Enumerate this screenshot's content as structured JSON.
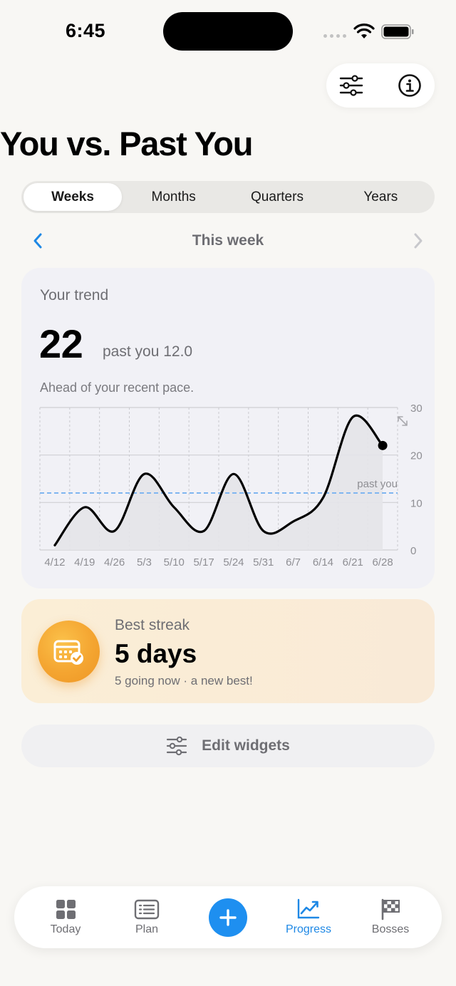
{
  "status_bar": {
    "time": "6:45"
  },
  "header": {
    "title": "You vs. Past You",
    "filters_icon": "sliders-icon",
    "info_icon": "info-circle-icon"
  },
  "segments": [
    {
      "label": "Weeks",
      "active": true
    },
    {
      "label": "Months",
      "active": false
    },
    {
      "label": "Quarters",
      "active": false
    },
    {
      "label": "Years",
      "active": false
    }
  ],
  "period": {
    "label": "This week"
  },
  "trend": {
    "label": "Your trend",
    "value": "22",
    "past_label": "past you 12.0",
    "note": "Ahead of your recent pace."
  },
  "chart_data": {
    "type": "line",
    "categories": [
      "4/12",
      "4/19",
      "4/26",
      "5/3",
      "5/10",
      "5/17",
      "5/24",
      "5/31",
      "6/7",
      "6/14",
      "6/21",
      "6/28"
    ],
    "series": [
      {
        "values": [
          1,
          9,
          4,
          16,
          9,
          4,
          16,
          4,
          6,
          11,
          28,
          22
        ]
      }
    ],
    "reference_line": {
      "label": "past you",
      "value": 12
    },
    "yticks": [
      "0",
      "10",
      "20",
      "30"
    ],
    "ylim": [
      0,
      30
    ],
    "y_axis_side": "right",
    "grid": true,
    "colors": {
      "line": "#000000",
      "area": "#e4e4e9",
      "reference": "#7fb6f0"
    }
  },
  "streak": {
    "label": "Best streak",
    "value": "5 days",
    "sub": "5 going now · a new best!",
    "icon": "calendar-check-icon"
  },
  "edit_widgets": {
    "label": "Edit widgets",
    "icon": "sliders-icon"
  },
  "tabbar": {
    "items": [
      {
        "label": "Today",
        "icon": "grid-icon"
      },
      {
        "label": "Plan",
        "icon": "list-card-icon"
      },
      {
        "label": "Progress",
        "icon": "trend-chart-icon",
        "active": true
      },
      {
        "label": "Bosses",
        "icon": "checkered-flag-icon"
      }
    ],
    "add_icon": "plus-icon",
    "active_color": "#1e88e5"
  }
}
